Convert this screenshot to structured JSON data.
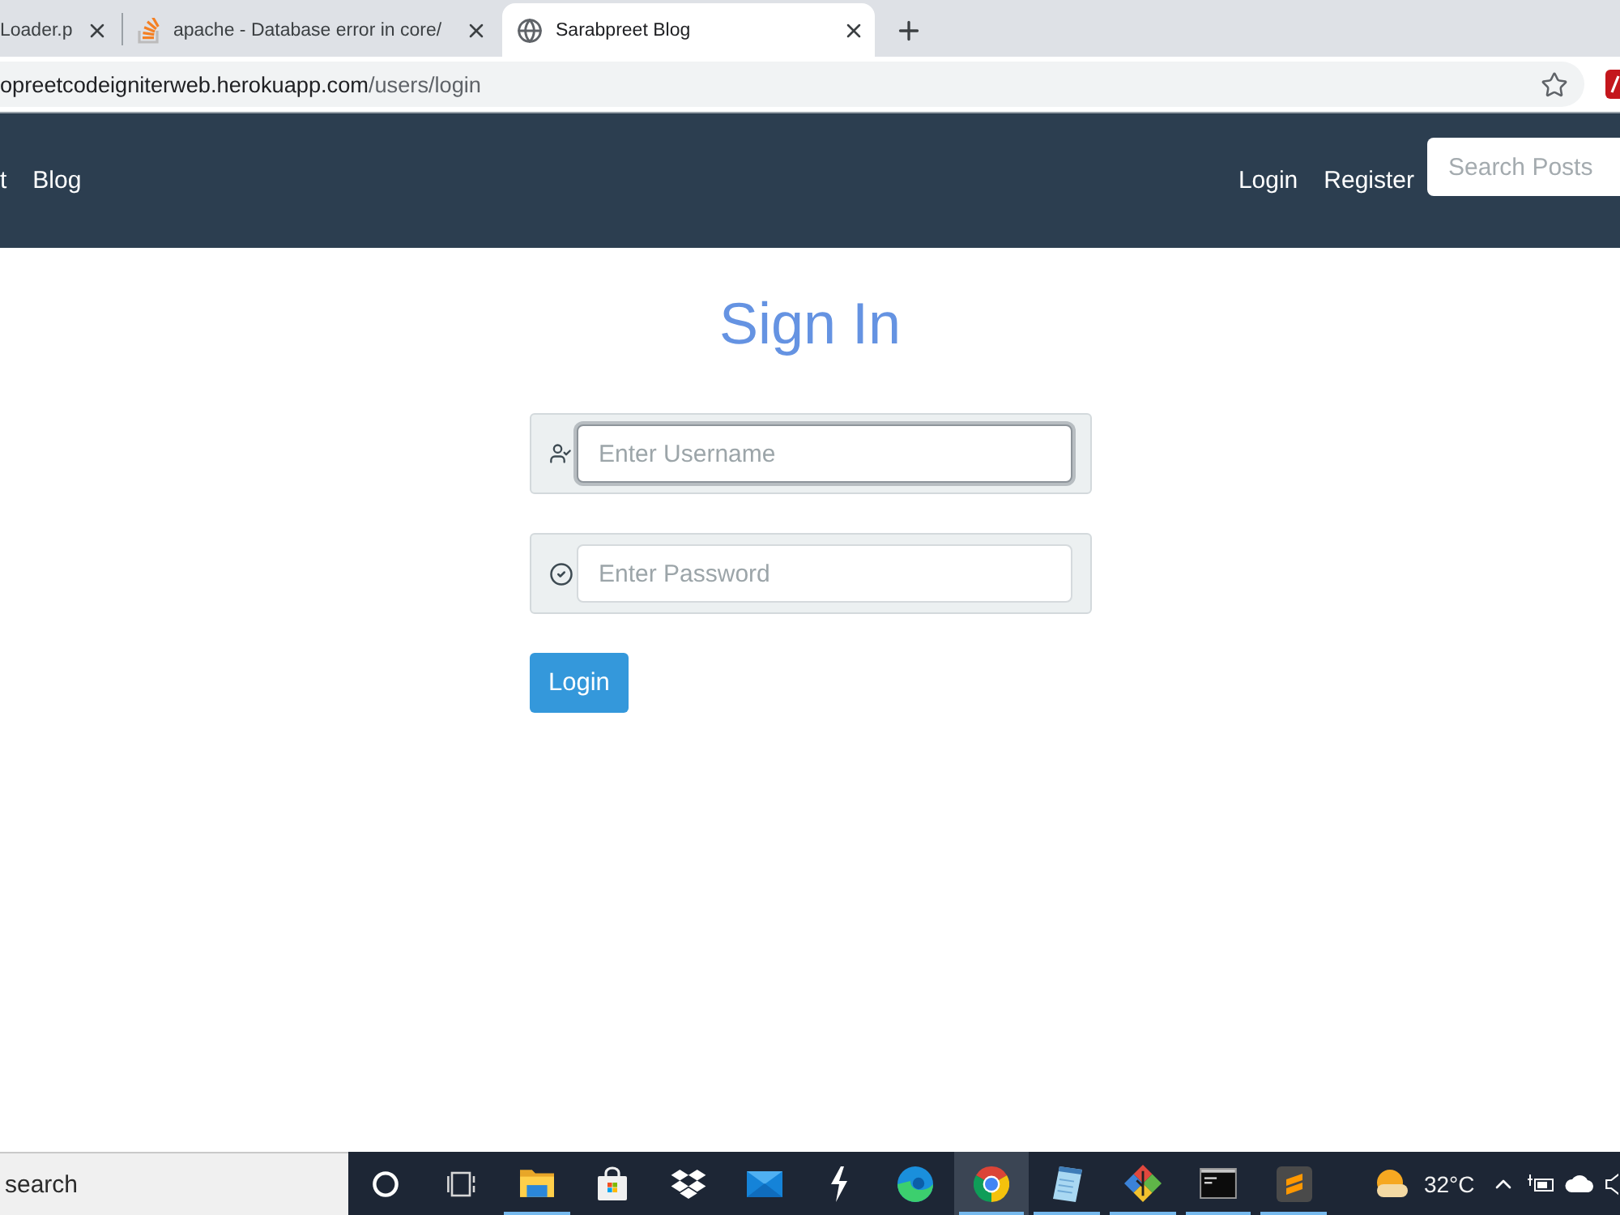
{
  "browser": {
    "tabs": [
      {
        "title": "Loader.p",
        "selected": false
      },
      {
        "title": "apache - Database error in core/",
        "selected": false
      },
      {
        "title": "Sarabpreet Blog",
        "selected": true
      }
    ],
    "address": {
      "host": "opreetcodeigniterweb.herokuapp.com",
      "path": "/users/login"
    }
  },
  "navbar": {
    "brand": "t",
    "links": [
      "Blog"
    ],
    "right_links": [
      "Login",
      "Register"
    ],
    "search": {
      "placeholder": "Search Posts"
    }
  },
  "form": {
    "title": "Sign In",
    "fields": [
      {
        "placeholder": "Enter Username",
        "focused": true
      },
      {
        "placeholder": "Enter Password",
        "focused": false
      }
    ],
    "button": "Login"
  },
  "taskbar": {
    "search": {
      "placeholder": "search"
    },
    "apps": [
      {
        "running": true,
        "selected": false
      },
      {
        "running": false,
        "selected": false
      },
      {
        "running": false,
        "selected": false
      },
      {
        "running": false,
        "selected": false
      },
      {
        "running": false,
        "selected": false
      },
      {
        "running": false,
        "selected": false
      },
      {
        "running": true,
        "selected": true
      },
      {
        "running": true,
        "selected": false
      },
      {
        "running": true,
        "selected": false
      },
      {
        "running": true,
        "selected": false
      },
      {
        "running": true,
        "selected": false
      }
    ],
    "weather": {
      "temperature": "32°C"
    }
  }
}
